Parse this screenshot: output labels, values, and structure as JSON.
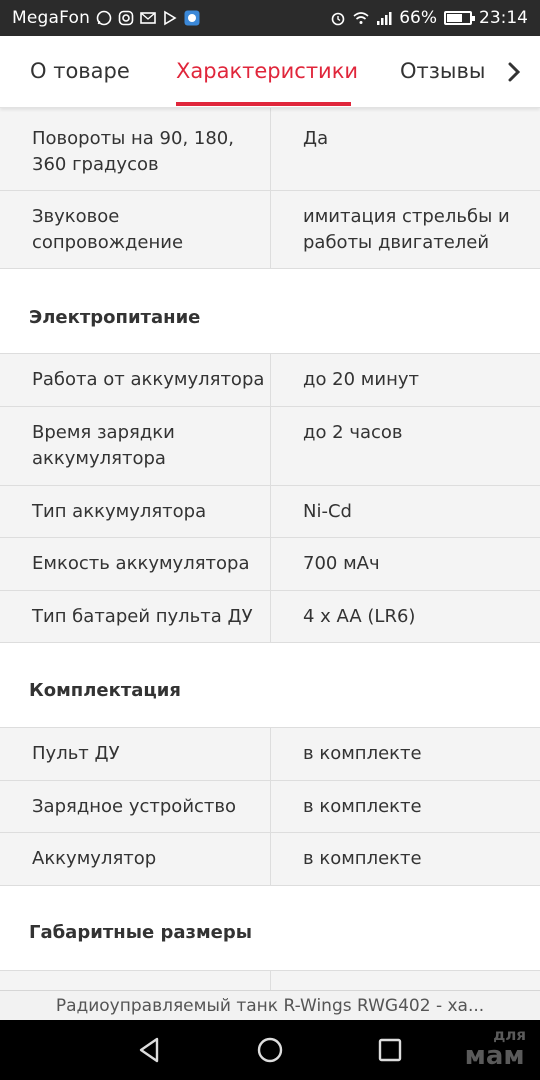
{
  "status_bar": {
    "carrier": "MegaFon",
    "battery": "66%",
    "battery_level": 0.66,
    "time": "23:14"
  },
  "tabs": [
    {
      "label": "О товаре",
      "active": false
    },
    {
      "label": "Характеристики",
      "active": true
    },
    {
      "label": "Отзывы",
      "active": false
    }
  ],
  "accent_color": "#e0263b",
  "spec_rows_top": [
    {
      "label": "Повороты на 90, 180, 360 градусов",
      "value": "Да"
    },
    {
      "label": "Звуковое сопровождение",
      "value": "имитация стрельбы и работы двигателей"
    }
  ],
  "sections": [
    {
      "title": "Электропитание",
      "rows": [
        {
          "label": "Работа от аккумулятора",
          "value": "до 20 минут"
        },
        {
          "label": "Время зарядки аккумулятора",
          "value": "до 2 часов"
        },
        {
          "label": "Тип аккумулятора",
          "value": "Ni-Cd"
        },
        {
          "label": "Емкость аккумулятора",
          "value": "700 мАч"
        },
        {
          "label": "Тип батарей пульта ДУ",
          "value": "4 x AA (LR6)"
        }
      ]
    },
    {
      "title": "Комплектация",
      "rows": [
        {
          "label": "Пульт ДУ",
          "value": "в комплекте"
        },
        {
          "label": "Зарядное устройство",
          "value": "в комплекте"
        },
        {
          "label": "Аккумулятор",
          "value": "в комплекте"
        }
      ]
    },
    {
      "title": "Габаритные размеры",
      "rows": []
    }
  ],
  "page_title": "Радиоуправляемый танк R-Wings RWG402 - ха...",
  "watermark": {
    "top": "для",
    "main": "мам"
  }
}
